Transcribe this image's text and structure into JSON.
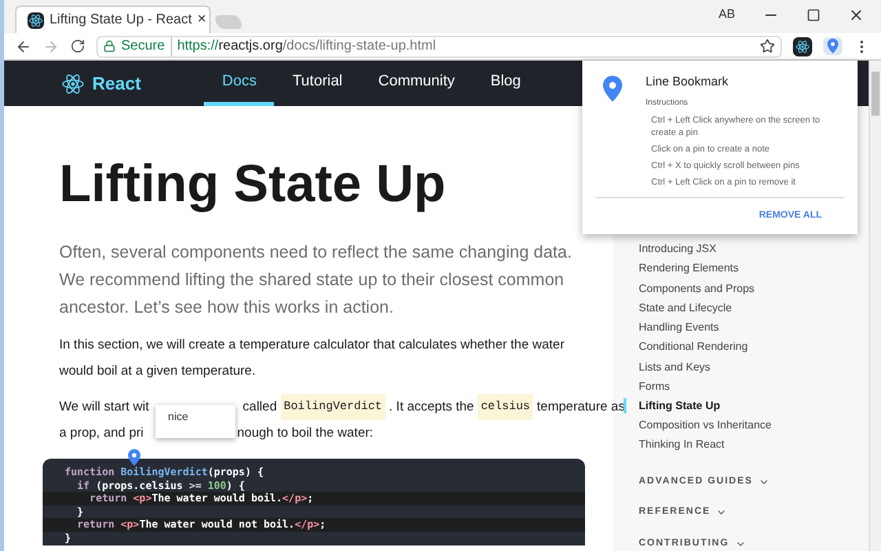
{
  "browser": {
    "tab": {
      "title": "Lifting State Up - React",
      "close": "×"
    },
    "profile": "AB",
    "address": {
      "secure_label": "Secure",
      "scheme": "https://",
      "domain": "reactjs.org",
      "path": "/docs/lifting-state-up.html"
    }
  },
  "nav": {
    "brand": "React",
    "links": [
      {
        "label": "Docs",
        "selected": true
      },
      {
        "label": "Tutorial",
        "selected": false
      },
      {
        "label": "Community",
        "selected": false
      },
      {
        "label": "Blog",
        "selected": false
      }
    ]
  },
  "popup": {
    "title": "Line Bookmark",
    "subtitle": "Instructions",
    "instructions": [
      "Ctrl + Left Click anywhere on the screen to create a pin",
      "Click on a pin to create a note",
      "Ctrl + X to quickly scroll between pins",
      "Ctrl + Left Click on a pin to remove it"
    ],
    "action": "REMOVE ALL"
  },
  "article": {
    "title": "Lifting State Up",
    "intro": "Often, several components need to reflect the same changing data. We recommend lifting the shared state up to their closest common ancestor. Let’s see how this works in action.",
    "paragraph": "In this section, we will create a temperature calculator that calculates whether the water would boil at a given temperature.",
    "covered_paragraph": {
      "line_1": [
        {
          "kind": "text",
          "text": "We will start wit"
        },
        {
          "kind": "gap"
        },
        {
          "kind": "text",
          "text": "called"
        },
        {
          "kind": "code",
          "text": "BoilingVerdict"
        },
        {
          "kind": "text",
          "text": ". It accepts the"
        },
        {
          "kind": "code",
          "text": "celsius"
        },
        {
          "kind": "text",
          "text": "temperature as"
        }
      ],
      "line_2": [
        {
          "kind": "text",
          "text": "a prop, and pri"
        },
        {
          "kind": "gap"
        },
        {
          "kind": "text",
          "text": "nough to boil the water:"
        }
      ]
    },
    "note": {
      "text": "nice"
    },
    "code": [
      {
        "highlighted": false,
        "tokens": [
          {
            "kind": "keyword",
            "text": "function "
          },
          {
            "kind": "name",
            "text": "BoilingVerdict"
          },
          {
            "kind": "plain",
            "text": "(props) {"
          }
        ]
      },
      {
        "highlighted": false,
        "tokens": [
          {
            "kind": "keyword",
            "text": "  if "
          },
          {
            "kind": "plain",
            "text": "(props.celsius "
          },
          {
            "kind": "operator",
            "text": ">= "
          },
          {
            "kind": "number",
            "text": "100"
          },
          {
            "kind": "plain",
            "text": ") {"
          }
        ]
      },
      {
        "highlighted": true,
        "tokens": [
          {
            "kind": "keyword",
            "text": "    return "
          },
          {
            "kind": "tag",
            "text": "<p>"
          },
          {
            "kind": "plain",
            "text": "The water would boil."
          },
          {
            "kind": "tag",
            "text": "</p>"
          },
          {
            "kind": "plain",
            "text": ";"
          }
        ]
      },
      {
        "highlighted": false,
        "tokens": [
          {
            "kind": "plain",
            "text": "  }"
          }
        ]
      },
      {
        "highlighted": true,
        "tokens": [
          {
            "kind": "keyword",
            "text": "  return "
          },
          {
            "kind": "tag",
            "text": "<p>"
          },
          {
            "kind": "plain",
            "text": "The water would not boil."
          },
          {
            "kind": "tag",
            "text": "</p>"
          },
          {
            "kind": "plain",
            "text": ";"
          }
        ]
      },
      {
        "highlighted": false,
        "tokens": [
          {
            "kind": "plain",
            "text": "}"
          }
        ]
      }
    ]
  },
  "sidebar": {
    "items": [
      {
        "label": "Introducing JSX",
        "selected": false
      },
      {
        "label": "Rendering Elements",
        "selected": false
      },
      {
        "label": "Components and Props",
        "selected": false
      },
      {
        "label": "State and Lifecycle",
        "selected": false
      },
      {
        "label": "Handling Events",
        "selected": false
      },
      {
        "label": "Conditional Rendering",
        "selected": false
      },
      {
        "label": "Lists and Keys",
        "selected": false
      },
      {
        "label": "Forms",
        "selected": false
      },
      {
        "label": "Lifting State Up",
        "selected": true
      },
      {
        "label": "Composition vs Inheritance",
        "selected": false
      },
      {
        "label": "Thinking In React",
        "selected": false
      }
    ],
    "sections": [
      {
        "label": "ADVANCED GUIDES",
        "expanded": false
      },
      {
        "label": "REFERENCE",
        "expanded": false
      },
      {
        "label": "CONTRIBUTING",
        "expanded": false
      }
    ]
  }
}
